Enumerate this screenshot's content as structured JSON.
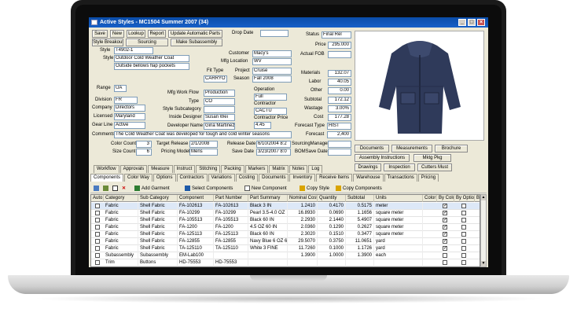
{
  "window": {
    "title": "Active Styles - MC1504 Summer 2007 (34)",
    "min": "_",
    "max": "□",
    "close": "×"
  },
  "toolbar_buttons": {
    "save": "Save",
    "new": "New",
    "lookup": "Lookup",
    "report": "Report",
    "update_auto_parts": "Update Automatic Parts",
    "style_breakout": "Style Breakout",
    "sourcing": "Sourcing",
    "make_subassembly": "Make Subassembly"
  },
  "header": {
    "drop_date_label": "Drop Date",
    "drop_date": "",
    "status_label": "Status",
    "status": "Final Rel",
    "price_label": "Price",
    "price": "295.000",
    "actual_fob_label": "Actual FOB",
    "actual_fob": ""
  },
  "style": {
    "style_label": "Style",
    "style_code": "T4902-1",
    "name_label": "Style",
    "name": "Outdoor Cold Weather Coat",
    "description": "Outside bellows flap pockets",
    "customer_label": "Customer",
    "customer": "Macy's",
    "mfg_location_label": "Mfg Location",
    "mfg_location": "WV",
    "fit_type_label": "Fit Type",
    "fit_type": "CARRYO",
    "project_label": "Project",
    "project": "Cruise",
    "season_label": "Season",
    "season": "Fall 2008",
    "range_label": "Range",
    "range": "UA",
    "mfg_work_flow_label": "Mfg Work Flow",
    "mfg_work_flow": "Production",
    "operation_label": "Operation",
    "operation": "Full",
    "division_label": "Division",
    "division": "FR",
    "type_label": "Type",
    "type": "CO",
    "contractor_label": "Contractor",
    "contractor": "CACTU",
    "company_label": "Company",
    "company": "Directors",
    "style_subcategory_label": "Style Subcategory",
    "style_subcategory": "",
    "licensed_label": "Licensed",
    "licensed": "Maryland",
    "inside_designer_label": "Inside Designer",
    "inside_designer": "Susan Wei",
    "contractor_price_label": "Contractor Price",
    "contractor_price": "4.45",
    "gear_line_label": "Gear Line",
    "gear_line": "Active",
    "developer_name_label": "Developer Name",
    "developer_name": "Gina Martinez",
    "forecast_type_label": "Forecast Type",
    "forecast_type": "HIST",
    "comments_label": "Comments",
    "comments": "The Cold Weather Coat was developed for tough and cold winter seasons",
    "forecast_label": "Forecast",
    "forecast": "2,400",
    "color_count_label": "Color Count",
    "color_count": "3",
    "target_release_label": "Target Release",
    "target_release": "2/1/2008",
    "release_date_label": "Release Date",
    "release_date": "6/10/2004 8:2",
    "sourcing_manager_label": "SourcingManager",
    "sourcing_manager": "",
    "size_count_label": "Size Count",
    "size_count": "6",
    "pricing_model_label": "Pricing Model",
    "pricing_model": "Mens",
    "save_date_label": "Save Date",
    "save_date": "3/23/2007 8:0",
    "bom_save_date_label": "BOMSave Date",
    "bom_save_date": ""
  },
  "costs": {
    "materials_label": "Materials",
    "materials": "132.07",
    "labor_label": "Labor",
    "labor": "40.05",
    "other_label": "Other",
    "other": "0.00",
    "subtotal_label": "Subtotal",
    "subtotal": "172.12",
    "wastage_label": "Wastage",
    "wastage": "3.00%",
    "cost_label": "Cost",
    "cost": "177.28"
  },
  "side_buttons": {
    "documents": "Documents",
    "measurements": "Measurements",
    "brochure": "Brochure",
    "assembly_instructions": "Assembly Instructions",
    "mktg_pkg": "Mktg Pkg",
    "drawings": "Drawings",
    "inspection": "Inspection",
    "cutters_must": "Cutters Must"
  },
  "tabs_row1": [
    "Workflow",
    "Approvals",
    "Measure",
    "Instruct",
    "Stitching",
    "Packing",
    "Markers",
    "Matrix",
    "Notes",
    "Log"
  ],
  "tabs_row2": [
    "Components",
    "Color Way",
    "Options",
    "Contractors",
    "Variations",
    "Costing",
    "Documents",
    "Inventory",
    "Receive Items",
    "Warehouse",
    "Transactions",
    "Pricing"
  ],
  "grid_toolbar": {
    "add_garment": "Add Garment",
    "select_components": "Select Components",
    "new_component": "New Component",
    "copy_style": "Copy Style",
    "copy_components": "Copy Components"
  },
  "grid": {
    "columns": [
      "Auto",
      "Category",
      "Sub Category",
      "Component",
      "Part Number",
      "Part Summary",
      "Nominal Cost",
      "Quantity",
      "Subtotal",
      "Units",
      "Color",
      "By Color",
      "By Option",
      "By"
    ],
    "rows": [
      {
        "auto": false,
        "category": "Fabric",
        "sub_category": "Shell Fabric",
        "component": "FA-102613",
        "part_number": "FA-102613",
        "part_summary": "Black  3 IN",
        "nominal_cost": "1.2410",
        "quantity": "0.4170",
        "subtotal": "0.5175",
        "units": "meter",
        "by_color": true
      },
      {
        "auto": false,
        "category": "Fabric",
        "sub_category": "Shell Fabric",
        "component": "FA-10299",
        "part_number": "FA-10299",
        "part_summary": "Pearl  3.5-4.0 OZ",
        "nominal_cost": "16.8930",
        "quantity": "0.0690",
        "subtotal": "1.1656",
        "units": "square meter",
        "by_color": true
      },
      {
        "auto": false,
        "category": "Fabric",
        "sub_category": "Shell Fabric",
        "component": "FA-105513",
        "part_number": "FA-105513",
        "part_summary": "Black  60 IN",
        "nominal_cost": "2.2930",
        "quantity": "2.1440",
        "subtotal": "5.4907",
        "units": "square meter",
        "by_color": true
      },
      {
        "auto": false,
        "category": "Fabric",
        "sub_category": "Shell Fabric",
        "component": "FA-1200",
        "part_number": "FA-1200",
        "part_summary": "4.5 OZ 60 IN",
        "nominal_cost": "2.0360",
        "quantity": "0.1290",
        "subtotal": "0.2627",
        "units": "square meter",
        "by_color": true
      },
      {
        "auto": false,
        "category": "Fabric",
        "sub_category": "Shell Fabric",
        "component": "FA-125113",
        "part_number": "FA-125113",
        "part_summary": "Black  60 IN",
        "nominal_cost": "2.3020",
        "quantity": "0.1510",
        "subtotal": "0.3477",
        "units": "square meter",
        "by_color": true
      },
      {
        "auto": false,
        "category": "Fabric",
        "sub_category": "Shell Fabric",
        "component": "FA-12855",
        "part_number": "FA-12855",
        "part_summary": "Navy Blue  6 OZ 6",
        "nominal_cost": "29.5070",
        "quantity": "0.3750",
        "subtotal": "11.0651",
        "units": "yard",
        "by_color": true
      },
      {
        "auto": false,
        "category": "Fabric",
        "sub_category": "Shell Fabric",
        "component": "TA-125110",
        "part_number": "TA-125110",
        "part_summary": "White  3 FINE",
        "nominal_cost": "11.7260",
        "quantity": "0.1000",
        "subtotal": "1.1726",
        "units": "yard",
        "by_color": true
      },
      {
        "auto": false,
        "category": "Subassembly",
        "sub_category": "Subassembly",
        "component": "EM-Lab100",
        "part_number": "",
        "part_summary": "",
        "nominal_cost": "1.3900",
        "quantity": "1.0000",
        "subtotal": "1.3900",
        "units": "each",
        "by_color": false
      },
      {
        "auto": false,
        "category": "Trim",
        "sub_category": "Buttons",
        "component": "HD-75553",
        "part_number": "HD-75553",
        "part_summary": "",
        "nominal_cost": "",
        "quantity": "",
        "subtotal": "",
        "units": "",
        "by_color": false
      }
    ]
  }
}
